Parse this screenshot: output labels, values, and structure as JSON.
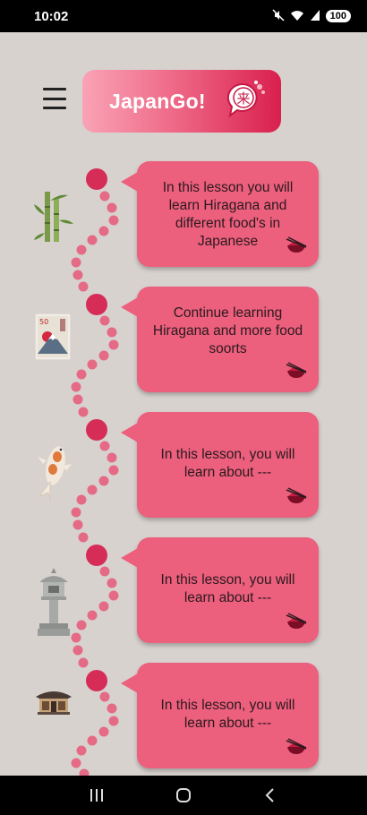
{
  "status_bar": {
    "time": "10:02",
    "battery": "100",
    "icons": [
      "mute-icon",
      "wifi-icon",
      "signal-icon",
      "battery-icon"
    ]
  },
  "header": {
    "app_name": "JapanGo!",
    "logo_glyph": "来"
  },
  "lessons": [
    {
      "text": "In this lesson you will learn Hiragana and different food's in Japanese",
      "icon": "bamboo-icon"
    },
    {
      "text": "Continue learning Hiragana and more food soorts",
      "icon": "mount-fuji-stamp-icon"
    },
    {
      "text": "In this lesson, you will learn about ---",
      "icon": "koi-fish-icon"
    },
    {
      "text": "In this lesson, you will learn about ---",
      "icon": "stone-lantern-icon"
    },
    {
      "text": "In this lesson, you will learn about ---",
      "icon": "japanese-house-icon"
    }
  ],
  "stamp_label": "50",
  "colors": {
    "background": "#d8d2cf",
    "card": "#ec5f7d",
    "node": "#d52d58",
    "path_dot": "#e46a86"
  }
}
